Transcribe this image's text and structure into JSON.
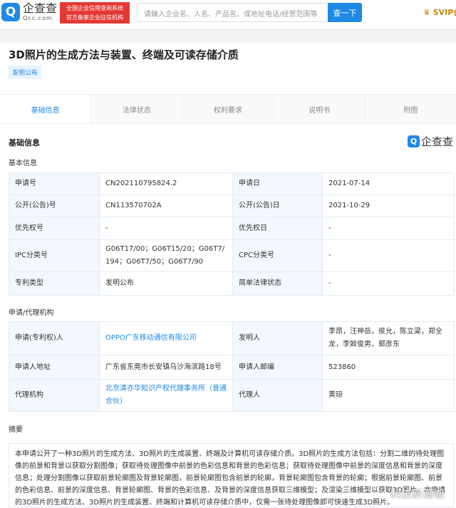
{
  "header": {
    "logo_cn": "企查查",
    "logo_en": "Qcc.com",
    "badge_line1": "全国企业信用查询系统",
    "badge_line2": "官方备案企业征信机构",
    "search_placeholder": "请输入企业名、人名、产品名，或地址电话/经营范围等",
    "search_button": "查一下",
    "svip": "SVIP会"
  },
  "patent": {
    "title": "3D照片的生成方法与装置、终端及可读存储介质",
    "type_badge": "发明公布"
  },
  "tabs": [
    "基础信息",
    "法律状态",
    "权利要求",
    "说明书",
    "附图"
  ],
  "section_title": "基础信息",
  "watermark_logo": "企查查",
  "basic": {
    "heading": "基本信息",
    "rows": [
      [
        "申请号",
        "CN202110795824.2",
        "申请日",
        "2021-07-14"
      ],
      [
        "公开(公告)号",
        "CN113570702A",
        "公开(公告)日",
        "2021-10-29"
      ],
      [
        "优先权号",
        "-",
        "优先权日",
        "-"
      ],
      [
        "IPC分类号",
        "G06T17/00；G06T15/20；G06T7/194；G06T7/50；G06T7/90",
        "CPC分类号",
        "-"
      ],
      [
        "专利类型",
        "发明公布",
        "简单法律状态",
        "-"
      ]
    ]
  },
  "agency": {
    "heading": "申请/代理机构",
    "rows": [
      [
        "申请(专利权)人",
        "OPPO广东移动通信有限公司",
        "发明人",
        "李昂，汪神岳，侯允，陈立梁，郑全龙，李姬俊男，郭彦东"
      ],
      [
        "申请人地址",
        "广东省东莞市长安镇乌沙海滨路18号",
        "申请人邮编",
        "523860"
      ],
      [
        "代理机构",
        "北京清亦华知识产权代理事务所（普通合伙）",
        "代理人",
        "黄琼"
      ]
    ]
  },
  "abstract": {
    "heading": "摘要",
    "text": "本申请公开了一种3D照片的生成方法、3D照片的生成装置、终端及计算机可读存储介质。3D照片的生成方法包括：分割二维的待处理图像的前景和背景以获取分割图像；获取待处理图像中前景的色彩信息和背景的色彩信息；获取待处理图像中前景的深度信息和背景的深度信息；处理分割图像以获取前景轮廓图及背景轮廓图，前景轮廓图包含前景的轮廓，背景轮廓图包含背景的轮廓；根据前景轮廓图、前景的色彩信息、前景的深度信息、背景轮廓图、背景的色彩信息、及背景的深度信息获取三维模型；及渲染三维模型以获取3D照片。本申请的3D照片的生成方法、3D照片的生成装置、终端和计算机可读存储介质中，仅需一张待处理图像即可快速生成3D照片。"
  },
  "corner_watermark": "科技新潮咖"
}
